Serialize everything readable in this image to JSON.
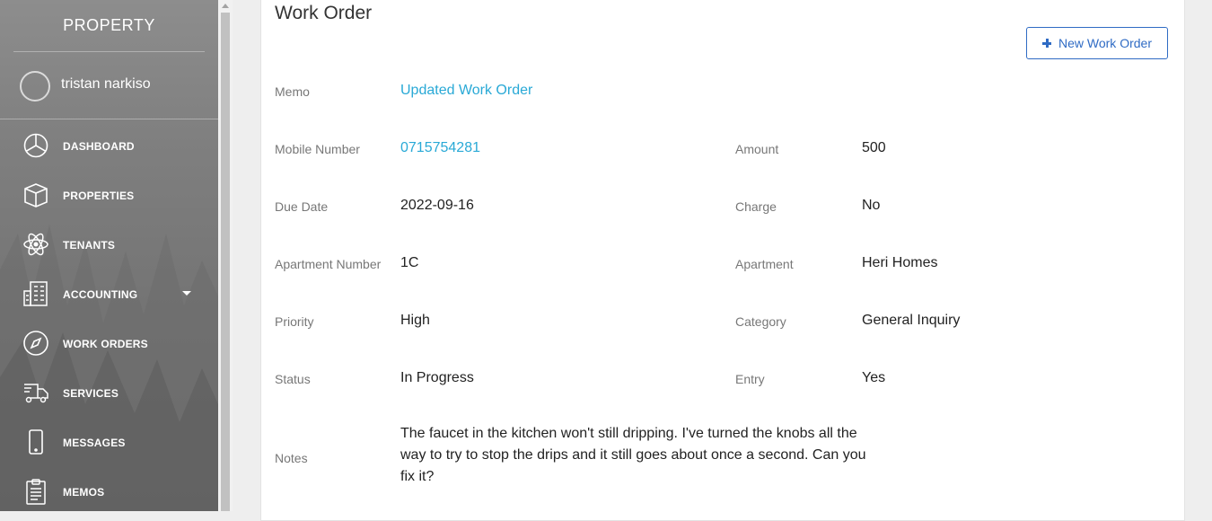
{
  "sidebar": {
    "brand": "PROPERTY",
    "user_name": "tristan narkiso",
    "items": [
      {
        "label": "DASHBOARD",
        "icon": "pie-chart-icon"
      },
      {
        "label": "PROPERTIES",
        "icon": "box-icon"
      },
      {
        "label": "TENANTS",
        "icon": "atom-icon"
      },
      {
        "label": "ACCOUNTING",
        "icon": "building-icon",
        "has_dropdown": true
      },
      {
        "label": "WORK ORDERS",
        "icon": "compass-icon"
      },
      {
        "label": "SERVICES",
        "icon": "delivery-truck-icon"
      },
      {
        "label": "MESSAGES",
        "icon": "mobile-phone-icon"
      },
      {
        "label": "MEMOS",
        "icon": "clipboard-icon"
      }
    ]
  },
  "main": {
    "title": "Work Order",
    "new_button_label": "New Work Order",
    "fields": {
      "memo": {
        "label": "Memo",
        "value": "Updated Work Order"
      },
      "mobile_number": {
        "label": "Mobile Number",
        "value": "0715754281"
      },
      "amount": {
        "label": "Amount",
        "value": "500"
      },
      "due_date": {
        "label": "Due Date",
        "value": "2022-09-16"
      },
      "charge": {
        "label": "Charge",
        "value": "No"
      },
      "apartment_number": {
        "label": "Apartment Number",
        "value": "1C"
      },
      "apartment": {
        "label": "Apartment",
        "value": "Heri Homes"
      },
      "priority": {
        "label": "Priority",
        "value": "High"
      },
      "category": {
        "label": "Category",
        "value": "General Inquiry"
      },
      "status": {
        "label": "Status",
        "value": "In Progress"
      },
      "entry": {
        "label": "Entry",
        "value": "Yes"
      },
      "notes": {
        "label": "Notes",
        "value": "The faucet in the kitchen won't still dripping. I've turned the knobs all the way to try to stop the drips and it still goes about once a second. Can you fix it?"
      }
    }
  },
  "colors": {
    "accent_link": "#29a9d6",
    "button_blue": "#2f6bc4",
    "sidebar_bg": "#7f7f7f"
  }
}
